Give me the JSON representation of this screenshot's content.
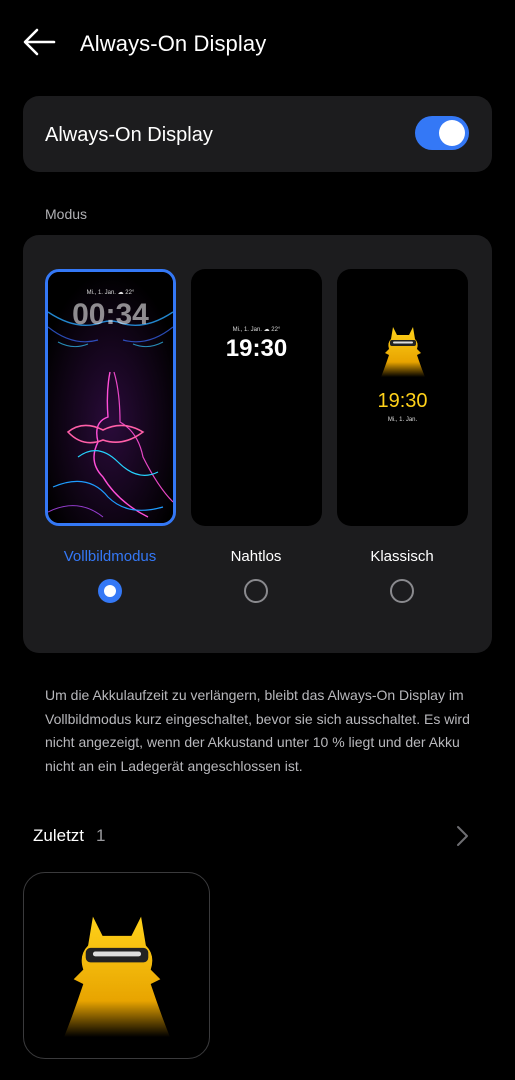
{
  "header": {
    "title": "Always-On Display",
    "back_icon": "arrow-left-icon"
  },
  "aod": {
    "label": "Always-On Display",
    "toggle_on": true,
    "accent": "#3478f6"
  },
  "section": {
    "modus_label": "Modus"
  },
  "modes": [
    {
      "label": "Vollbildmodus",
      "selected": true,
      "preview_date": "Mi., 1. Jan.  ☁ 22°",
      "preview_time": "00:34"
    },
    {
      "label": "Nahtlos",
      "selected": false,
      "preview_date": "Mi., 1. Jan.  ☁ 22°",
      "preview_time": "19:30"
    },
    {
      "label": "Klassisch",
      "selected": false,
      "preview_date": "Mi., 1. Jan.",
      "preview_time": "19:30"
    }
  ],
  "info": "Um die Akkulaufzeit zu verlängern, bleibt das Always-On Display im Vollbildmodus kurz eingeschaltet, bevor sie sich ausschaltet. Es wird nicht angezeigt, wenn der Akkustand unter 10 % liegt und der Akku nicht an ein Ladegerät angeschlossen ist.",
  "recent": {
    "title": "Zuletzt",
    "count": "1"
  }
}
